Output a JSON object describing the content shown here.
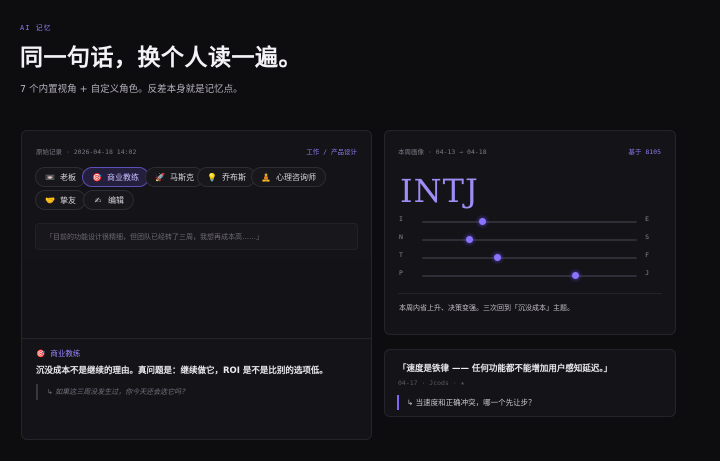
{
  "header": {
    "eyebrow": "AI 记忆",
    "title": "同一句话，换个人读一遍。",
    "subtitle": "7 个内置视角 + 自定义角色。反差本身就是记忆点。"
  },
  "left_panel": {
    "record_label": "原始记录 · 2026-04-18 14:02",
    "context_label": "工作 / 产品设计",
    "personas": [
      {
        "icon": "📼",
        "label": "老板"
      },
      {
        "icon": "🎯",
        "label": "商业教练",
        "active": true
      },
      {
        "icon": "🚀",
        "label": "马斯克"
      },
      {
        "icon": "💡",
        "label": "乔布斯"
      },
      {
        "icon": "🧘",
        "label": "心理咨询师"
      },
      {
        "icon": "🤝",
        "label": "挚友"
      },
      {
        "icon": "✍",
        "label": "编辑"
      }
    ],
    "original_quote": "「目前的功能设计很精细，但团队已经转了三周，我想再成本高……」",
    "active_persona": {
      "icon": "🎯",
      "label": "商业教练"
    },
    "response": "沉没成本不是继续的理由。真问题是：继续做它，ROI 是不是比别的选项低。",
    "followup": "↳ 如果这三周没发生过，你今天还会选它吗？"
  },
  "right_top": {
    "range_label": "本周画像 · 04-13 → 04-18",
    "basis_label": "基于 8105",
    "type": "INTJ",
    "axes": [
      {
        "left": "I",
        "right": "E",
        "value": 0.28
      },
      {
        "left": "N",
        "right": "S",
        "value": 0.22
      },
      {
        "left": "T",
        "right": "F",
        "value": 0.35
      },
      {
        "left": "P",
        "right": "J",
        "value": 0.71
      }
    ],
    "summary": "本周内省上升、决策变强。三次回到「沉没成本」主题。"
  },
  "right_bot": {
    "quote": "「速度是铁律 —— 任何功能都不能增加用户感知延迟。」",
    "meta": "04-17 · Jcods · ★",
    "reflection": "↳ 当速度和正确冲突，哪一个先让步？"
  }
}
